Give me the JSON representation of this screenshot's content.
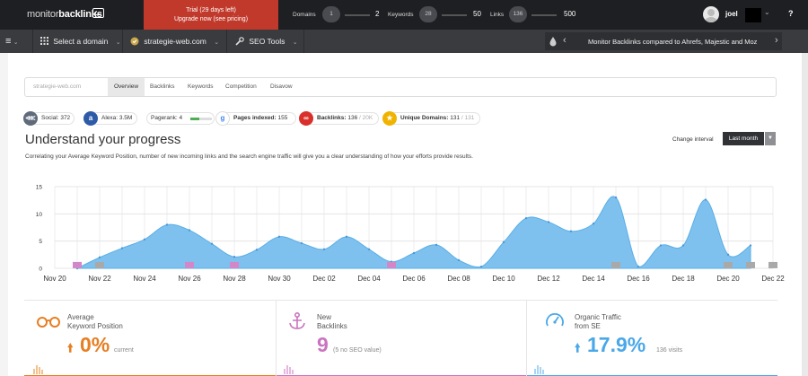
{
  "topbar": {
    "logo_prefix": "monitor",
    "logo_bold": "backlinks",
    "trial_line1": "Trial (29 days left)",
    "trial_line2": "Upgrade now (see pricing)",
    "domains_label": "Domains",
    "domains_value": "1",
    "domains_max": "2",
    "keywords_label": "Keywords",
    "keywords_value": "28",
    "keywords_max": "50",
    "links_label": "Links",
    "links_value": "136",
    "links_max": "500",
    "username": "joel",
    "help": "?"
  },
  "navbar": {
    "menu_icon": "≡",
    "select_domain": "Select a domain",
    "current_domain": "strategie-web.com",
    "seo_tools": "SEO Tools",
    "promo_text": "Monitor Backlinks compared to Ahrefs, Majestic and Moz"
  },
  "tabs": [
    {
      "label": "strategie-web.com"
    },
    {
      "label": "Overview"
    },
    {
      "label": "Backlinks"
    },
    {
      "label": "Keywords"
    },
    {
      "label": "Competition"
    },
    {
      "label": "Disavow"
    }
  ],
  "metrics": {
    "social": {
      "label": "Social:",
      "value": "372"
    },
    "alexa": {
      "label": "Alexa:",
      "value": "3.5M"
    },
    "pagerank": {
      "label": "Pagerank:",
      "value": "4"
    },
    "pages_indexed": {
      "label": "Pages indexed:",
      "value": "155"
    },
    "backlinks": {
      "label": "Backlinks:",
      "value": "136",
      "sub": " / 20K"
    },
    "unique_domains": {
      "label": "Unique Domains:",
      "value": "131",
      "sub": " / 131"
    }
  },
  "section": {
    "title": "Understand your progress",
    "description": "Correlating your Average Keyword Position, number of new incoming links and the search engine traffic will give you a clear understanding of how your efforts provide results.",
    "change_interval": "Change interval",
    "period": "Last month"
  },
  "chart_data": {
    "type": "area",
    "ylim": [
      0,
      15
    ],
    "yticks": [
      0,
      5,
      10,
      15
    ],
    "xticks": [
      "Nov 20",
      "Nov 22",
      "Nov 24",
      "Nov 26",
      "Nov 28",
      "Nov 30",
      "Dec 02",
      "Dec 04",
      "Dec 06",
      "Dec 08",
      "Dec 10",
      "Dec 12",
      "Dec 14",
      "Dec 16",
      "Dec 18",
      "Dec 20",
      "Dec 22"
    ],
    "series": [
      {
        "color": "#7ec1ef",
        "x": [
          21,
          22,
          23,
          24,
          25,
          26,
          27,
          28,
          29,
          30,
          31,
          32,
          33,
          34,
          35,
          36,
          37,
          38,
          39,
          40,
          41,
          42,
          43,
          44,
          45,
          46,
          47,
          48,
          49,
          50,
          51
        ],
        "values": [
          0,
          2,
          3.7,
          5.3,
          8,
          7,
          4.5,
          2.1,
          3.4,
          5.8,
          4.6,
          3.5,
          5.8,
          3.5,
          1.2,
          2.8,
          4.3,
          1.5,
          0.3,
          4.8,
          9.2,
          8.5,
          6.8,
          8.2,
          13,
          0.3,
          4.2,
          4.2,
          12.6,
          2.5,
          4.2
        ]
      }
    ],
    "markers": [
      {
        "x": 21,
        "value": 1,
        "color": "#d387c8"
      },
      {
        "x": 22,
        "value": 1,
        "color": "#a9a9a9"
      },
      {
        "x": 26,
        "value": 1,
        "color": "#d387c8"
      },
      {
        "x": 28,
        "value": 1,
        "color": "#d387c8"
      },
      {
        "x": 35,
        "value": 1,
        "color": "#d387c8"
      },
      {
        "x": 45,
        "value": 1,
        "color": "#a9a9a9"
      },
      {
        "x": 50,
        "value": 1,
        "color": "#a9a9a9"
      },
      {
        "x": 51,
        "value": 1,
        "color": "#a9a9a9"
      },
      {
        "x": 52,
        "value": 1,
        "color": "#a9a9a9"
      }
    ]
  },
  "cards": [
    {
      "label_line1": "Average",
      "label_line2": "Keyword Position",
      "value": "0%",
      "note": "current",
      "color": "#e67e22",
      "icon": "glasses-icon"
    },
    {
      "label_line1": "New",
      "label_line2": "Backlinks",
      "value": "9",
      "note": "(5 no SEO value)",
      "color": "#c974c0",
      "icon": "anchor-icon"
    },
    {
      "label_line1": "Organic Traffic",
      "label_line2": "from SE",
      "value": "17.9%",
      "note": "136 visits",
      "color": "#4aa8e8",
      "icon": "speedometer-icon"
    }
  ]
}
